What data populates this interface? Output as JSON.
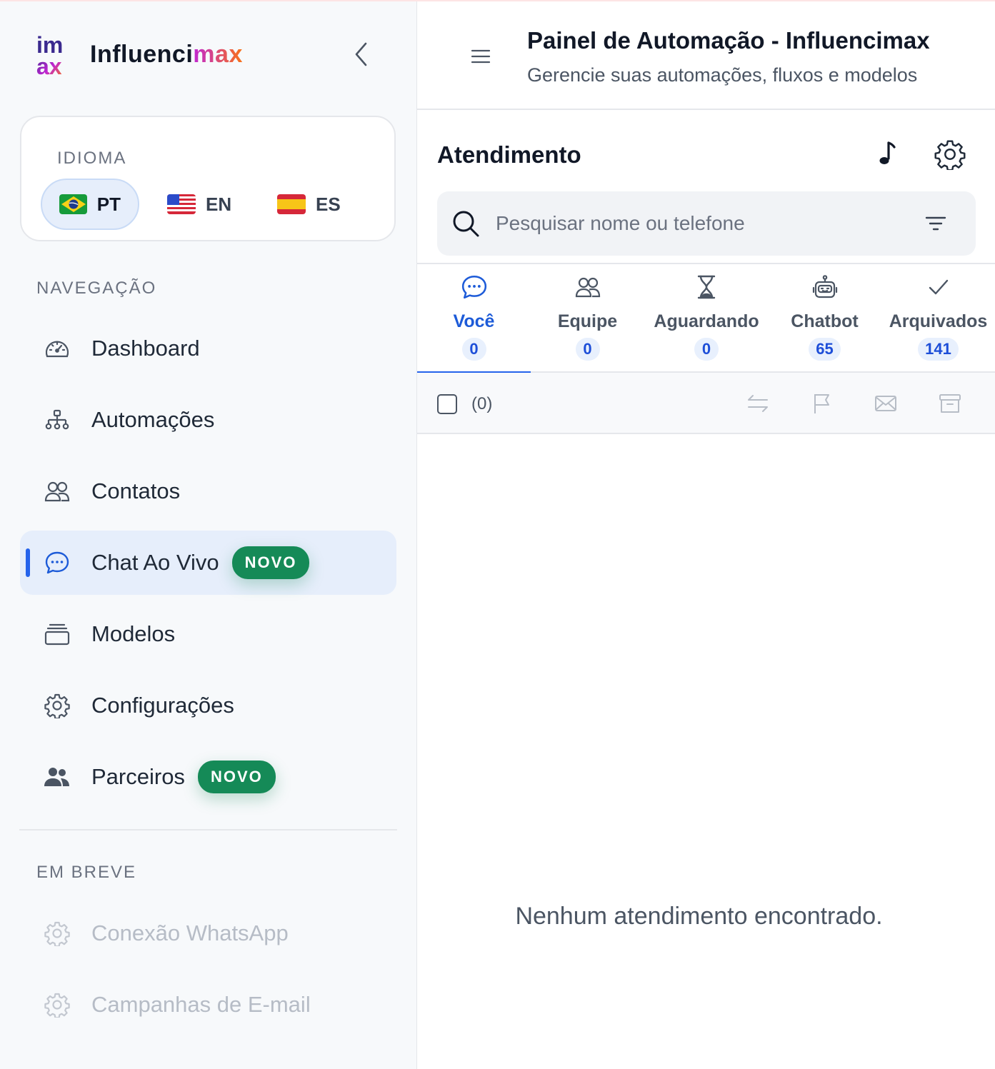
{
  "brand": {
    "name_prefix": "Influenci",
    "name_suffix": "max",
    "logo_text_top": "im",
    "logo_text_bottom": "ax"
  },
  "language": {
    "title": "IDIOMA",
    "options": [
      {
        "code": "PT",
        "flag": "brazil-flag",
        "active": true
      },
      {
        "code": "EN",
        "flag": "usa-flag",
        "active": false
      },
      {
        "code": "ES",
        "flag": "spain-flag",
        "active": false
      }
    ]
  },
  "nav": {
    "section_label": "NAVEGAÇÃO",
    "items": [
      {
        "label": "Dashboard",
        "icon": "gauge-icon"
      },
      {
        "label": "Automações",
        "icon": "sitemap-icon"
      },
      {
        "label": "Contatos",
        "icon": "users-icon"
      },
      {
        "label": "Chat Ao Vivo",
        "icon": "chat-icon",
        "active": true,
        "badge": "NOVO"
      },
      {
        "label": "Modelos",
        "icon": "layers-icon"
      },
      {
        "label": "Configurações",
        "icon": "gear-icon"
      },
      {
        "label": "Parceiros",
        "icon": "people-icon",
        "badge": "NOVO"
      }
    ]
  },
  "soon": {
    "section_label": "EM BREVE",
    "items": [
      {
        "label": "Conexão WhatsApp",
        "icon": "gear-icon"
      },
      {
        "label": "Campanhas de E-mail",
        "icon": "gear-icon"
      }
    ]
  },
  "header": {
    "title": "Painel de Automação - Influencimax",
    "subtitle": "Gerencie suas automações, fluxos e modelos"
  },
  "panel": {
    "title": "Atendimento",
    "search_placeholder": "Pesquisar nome ou telefone",
    "tabs": [
      {
        "label": "Você",
        "count": "0",
        "icon": "chat-icon",
        "active": true
      },
      {
        "label": "Equipe",
        "count": "0",
        "icon": "users-icon"
      },
      {
        "label": "Aguardando",
        "count": "0",
        "icon": "hourglass-icon"
      },
      {
        "label": "Chatbot",
        "count": "65",
        "icon": "robot-icon"
      },
      {
        "label": "Arquivados",
        "count": "141",
        "icon": "check-icon"
      }
    ],
    "selected_count": "(0)",
    "empty_message": "Nenhum atendimento encontrado."
  },
  "colors": {
    "accent": "#2563eb",
    "badge": "#158a57",
    "active_bg": "#e6eefb"
  }
}
